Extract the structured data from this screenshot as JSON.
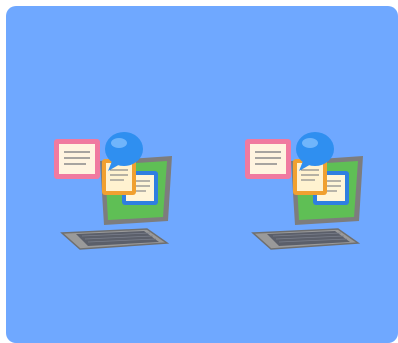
{
  "background_color": "#6fa8ff",
  "illustrations": [
    {
      "icon": "laptop-with-documents-and-chat-bubble-icon"
    },
    {
      "icon": "laptop-with-documents-and-chat-bubble-icon"
    }
  ],
  "colors": {
    "laptop_body": "#8a8a8a",
    "laptop_screen": "#5fbf55",
    "document_pink": "#f07aa0",
    "document_orange": "#f0a030",
    "document_blue": "#4a90e0",
    "chat_bubble": "#2f8ff0"
  }
}
